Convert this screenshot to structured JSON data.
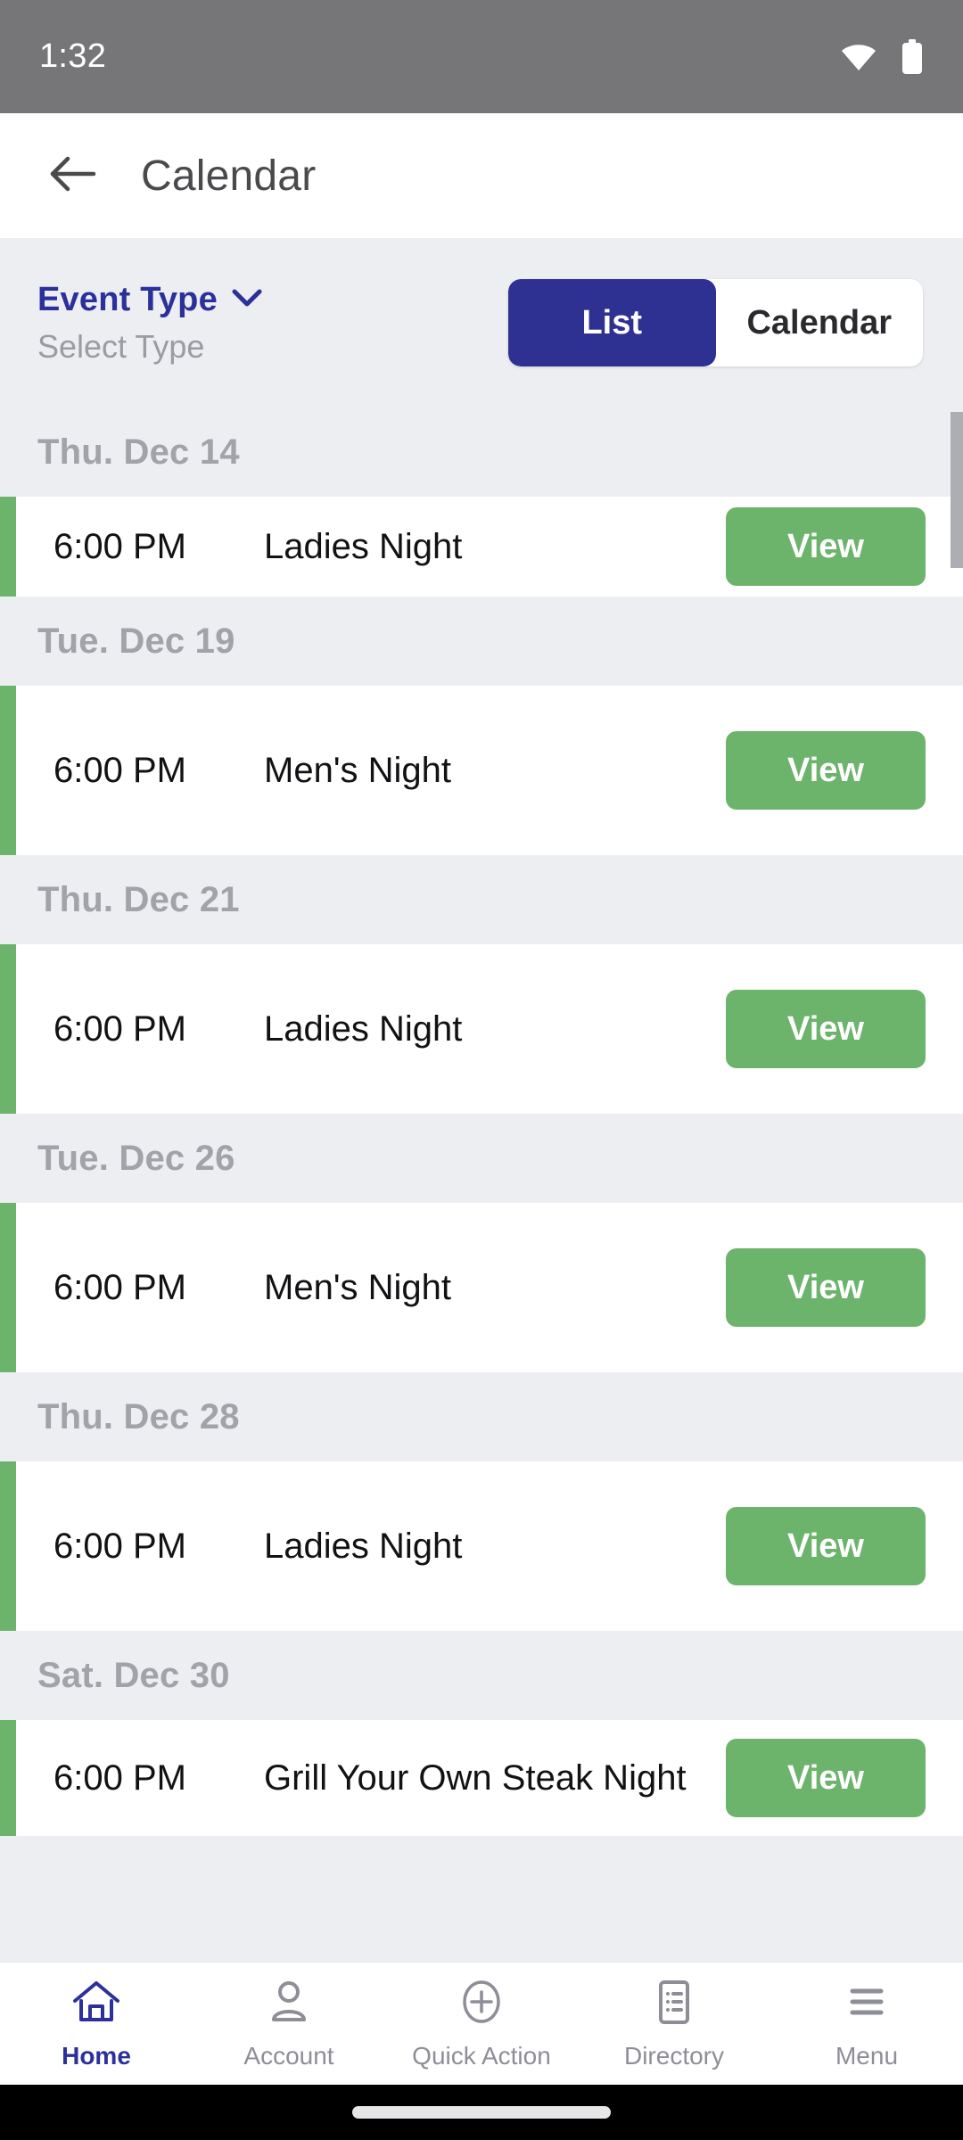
{
  "status_bar": {
    "time": "1:32",
    "wifi_icon": "wifi-icon",
    "battery_icon": "battery-icon"
  },
  "app_bar": {
    "back_icon": "back-arrow-icon",
    "title": "Calendar"
  },
  "filter_bar": {
    "event_type_label": "Event Type",
    "chevron_icon": "chevron-down-icon",
    "select_type_placeholder": "Select Type",
    "view_toggle": {
      "options": [
        "List",
        "Calendar"
      ],
      "selected": "List",
      "active_color": "#2e3192"
    }
  },
  "groups": [
    {
      "date": "Thu. Dec 14",
      "events": [
        {
          "time": "6:00 PM",
          "name": "Ladies Night",
          "action_label": "View",
          "accent_color": "#6cb36c"
        }
      ]
    },
    {
      "date": "Tue. Dec 19",
      "events": [
        {
          "time": "6:00 PM",
          "name": "Men's Night",
          "action_label": "View",
          "accent_color": "#6cb36c"
        }
      ]
    },
    {
      "date": "Thu. Dec 21",
      "events": [
        {
          "time": "6:00 PM",
          "name": "Ladies Night",
          "action_label": "View",
          "accent_color": "#6cb36c"
        }
      ]
    },
    {
      "date": "Tue. Dec 26",
      "events": [
        {
          "time": "6:00 PM",
          "name": "Men's Night",
          "action_label": "View",
          "accent_color": "#6cb36c"
        }
      ]
    },
    {
      "date": "Thu. Dec 28",
      "events": [
        {
          "time": "6:00 PM",
          "name": "Ladies Night",
          "action_label": "View",
          "accent_color": "#6cb36c"
        }
      ]
    },
    {
      "date": "Sat. Dec 30",
      "events": [
        {
          "time": "6:00 PM",
          "name": "Grill Your Own Steak Night",
          "action_label": "View",
          "accent_color": "#6cb36c"
        }
      ]
    }
  ],
  "bottom_nav": {
    "items": [
      {
        "label": "Home",
        "icon": "home-icon",
        "active": true
      },
      {
        "label": "Account",
        "icon": "person-icon",
        "active": false
      },
      {
        "label": "Quick Action",
        "icon": "plus-circle-icon",
        "active": false
      },
      {
        "label": "Directory",
        "icon": "list-document-icon",
        "active": false
      },
      {
        "label": "Menu",
        "icon": "hamburger-icon",
        "active": false
      }
    ],
    "active_color": "#2b309a",
    "inactive_color": "#8e8e98"
  }
}
